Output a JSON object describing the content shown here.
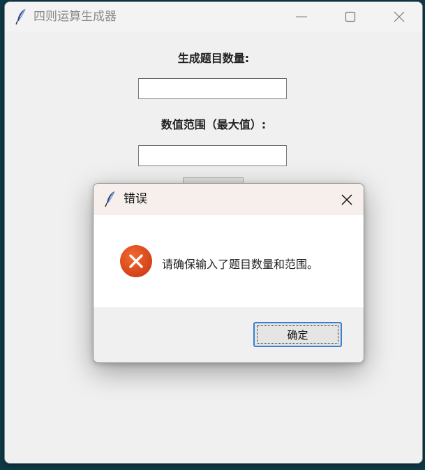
{
  "main_window": {
    "title": "四则运算生成器",
    "label_question_count": "生成题目数量:",
    "label_value_range": "数值范围（最大值）:",
    "question_count_value": "",
    "value_range_value": ""
  },
  "dialog": {
    "title": "错误",
    "message": "请确保输入了题目数量和范围。",
    "ok_label": "确定",
    "icon": "error-icon"
  },
  "colors": {
    "error_icon": "#e2521f",
    "ok_border": "#3a7fd0",
    "dialog_titlebar": "#f7efec"
  }
}
